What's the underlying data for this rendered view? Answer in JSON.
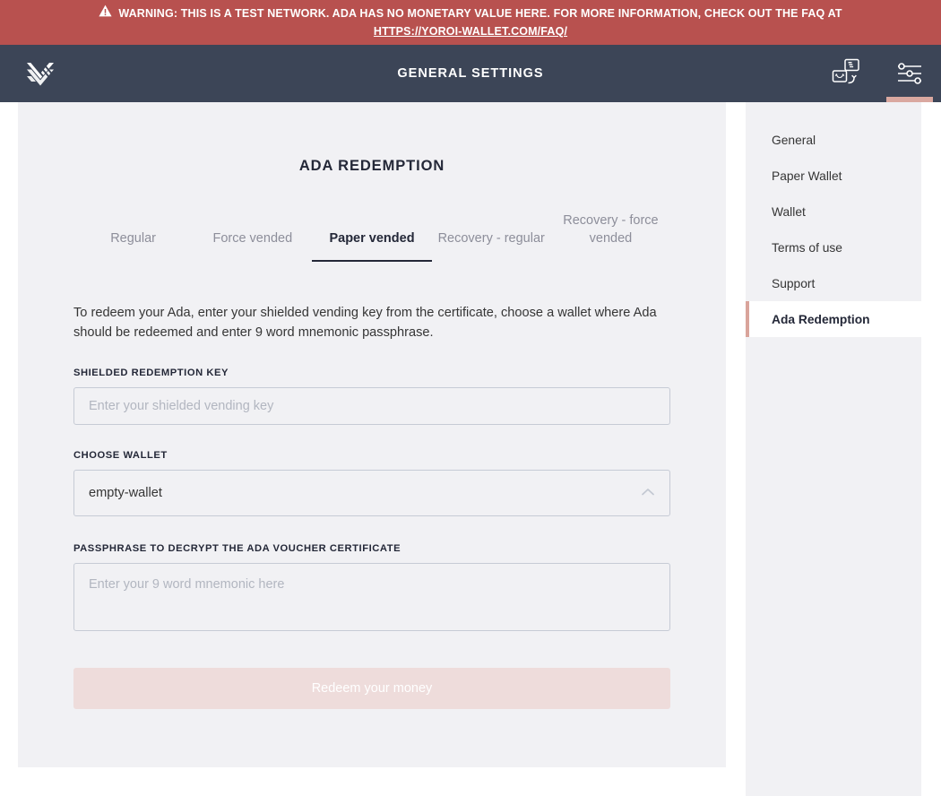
{
  "warning_banner": {
    "icon": "warning-triangle-icon",
    "text": "WARNING: THIS IS A TEST NETWORK. ADA HAS NO MONETARY VALUE HERE. FOR MORE INFORMATION, CHECK OUT THE FAQ AT",
    "link": "HTTPS://YOROI-WALLET.COM/FAQ/",
    "background_color": "#b8514f",
    "text_color": "#ffffff"
  },
  "topbar": {
    "logo": "yoroi-logo-icon",
    "title": "GENERAL SETTINGS",
    "background_color": "#3c4557",
    "actions": [
      {
        "icon": "wallet-switch-icon",
        "active": false
      },
      {
        "icon": "settings-sliders-icon",
        "active": true
      }
    ],
    "active_indicator_color": "#daa8a0"
  },
  "main": {
    "title": "ADA REDEMPTION",
    "tabs": [
      {
        "label": "Regular",
        "active": false
      },
      {
        "label": "Force vended",
        "active": false
      },
      {
        "label": "Paper vended",
        "active": true
      },
      {
        "label": "Recovery - regular",
        "active": false
      },
      {
        "label": "Recovery - force vended",
        "active": false
      }
    ],
    "intro": "To redeem your Ada, enter your shielded vending key from the certificate, choose a wallet where Ada should be redeemed and enter 9 word mnemonic passphrase.",
    "fields": {
      "redemption_key": {
        "label": "SHIELDED REDEMPTION KEY",
        "placeholder": "Enter your shielded vending key",
        "value": ""
      },
      "choose_wallet": {
        "label": "CHOOSE WALLET",
        "value": "empty-wallet",
        "chevron": "chevron-up-icon"
      },
      "passphrase": {
        "label": "PASSPHRASE TO DECRYPT THE ADA VOUCHER CERTIFICATE",
        "placeholder": "Enter your 9 word mnemonic here",
        "value": ""
      }
    },
    "submit": {
      "label": "Redeem your money",
      "disabled": true,
      "background_color": "#eedcdb"
    }
  },
  "settings_menu": {
    "items": [
      {
        "label": "General",
        "active": false
      },
      {
        "label": "Paper Wallet",
        "active": false
      },
      {
        "label": "Wallet",
        "active": false
      },
      {
        "label": "Terms of use",
        "active": false
      },
      {
        "label": "Support",
        "active": false
      },
      {
        "label": "Ada Redemption",
        "active": true
      }
    ],
    "active_border_color": "#d9a49b"
  }
}
